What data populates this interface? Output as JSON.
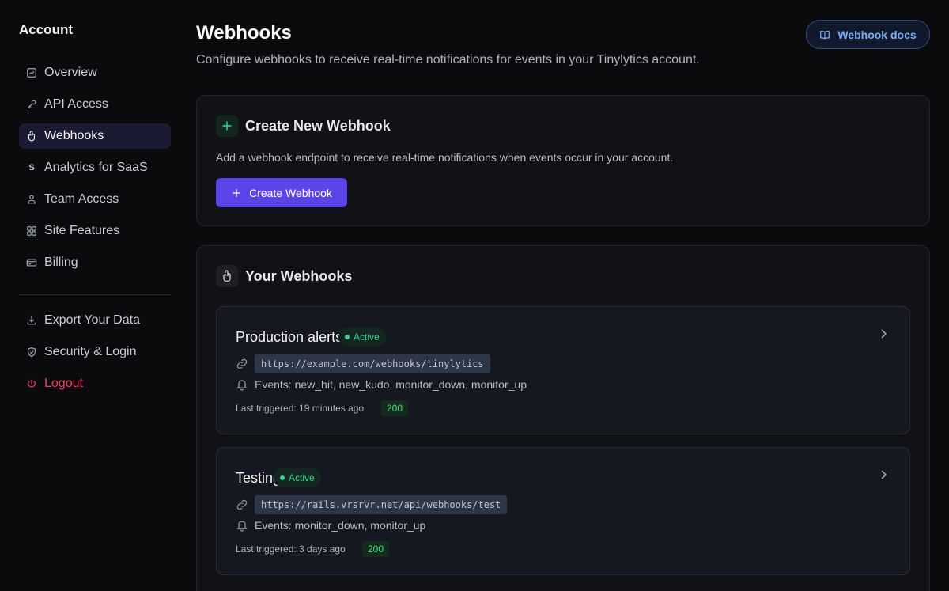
{
  "sidebar": {
    "title": "Account",
    "items": [
      {
        "label": "Overview",
        "icon": "chart-icon"
      },
      {
        "label": "API Access",
        "icon": "key-icon"
      },
      {
        "label": "Webhooks",
        "icon": "webhook-icon",
        "active": true
      },
      {
        "label": "Analytics for SaaS",
        "icon": "saas-icon",
        "glyph": "S"
      },
      {
        "label": "Team Access",
        "icon": "team-icon"
      },
      {
        "label": "Site Features",
        "icon": "grid-icon"
      },
      {
        "label": "Billing",
        "icon": "credit-card-icon"
      }
    ],
    "secondary": [
      {
        "label": "Export Your Data",
        "icon": "download-icon"
      },
      {
        "label": "Security & Login",
        "icon": "shield-icon"
      },
      {
        "label": "Logout",
        "icon": "power-icon"
      }
    ]
  },
  "header": {
    "title": "Webhooks",
    "subtitle": "Configure webhooks to receive real-time notifications for events in your Tinylytics account.",
    "docs_button": "Webhook docs"
  },
  "create": {
    "title": "Create New Webhook",
    "description": "Add a webhook endpoint to receive real-time notifications when events occur in your account.",
    "button": "Create Webhook"
  },
  "list": {
    "title": "Your Webhooks",
    "webhooks": [
      {
        "name": "Production alerts",
        "status": "Active",
        "url": "https://example.com/webhooks/tinylytics",
        "events": "Events: new_hit, new_kudo, monitor_down, monitor_up",
        "last_triggered": "Last triggered: 19 minutes ago",
        "code": "200"
      },
      {
        "name": "Testing",
        "status": "Active",
        "url": "https://rails.vrsrvr.net/api/webhooks/test",
        "events": "Events: monitor_down, monitor_up",
        "last_triggered": "Last triggered: 3 days ago",
        "code": "200"
      }
    ]
  },
  "colors": {
    "accent": "#5b45e8",
    "active_green": "#34d399",
    "logout_red": "#f43f5e",
    "docs_blue": "#7ab0f5"
  }
}
